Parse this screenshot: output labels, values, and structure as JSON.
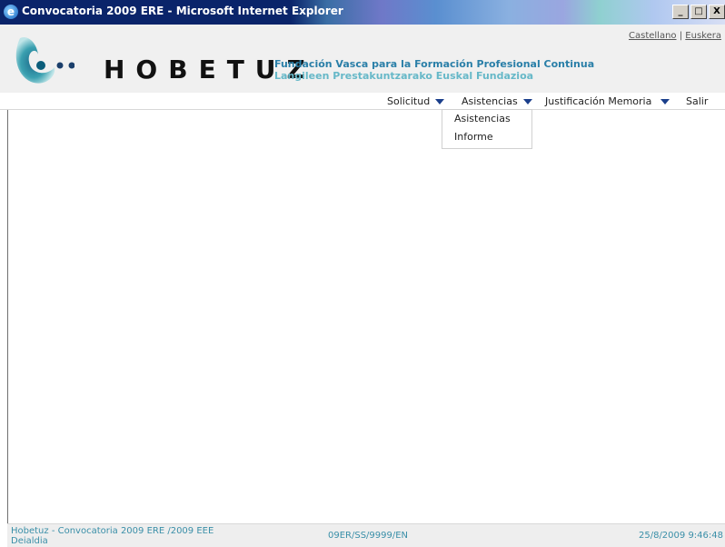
{
  "window": {
    "title": "Convocatoria 2009 ERE - Microsoft Internet Explorer",
    "icon": "ie-icon",
    "buttons": [
      "_",
      "□",
      "X"
    ]
  },
  "header": {
    "lang_castellano": "Castellano",
    "lang_separator": "|",
    "lang_euskera": "Euskera",
    "brand": "HOBETUZ",
    "tagline_line1": "Fundación Vasca para la Formación Profesional Continua",
    "tagline_line2": "Langileen Prestakuntzarako Euskal Fundazioa"
  },
  "nav": {
    "solicitud": "Solicitud",
    "asistencias": "Asistencias",
    "justificacion": "Justificación Memoria",
    "salir": "Salir"
  },
  "dropdown": {
    "items": [
      "Asistencias",
      "Informe"
    ]
  },
  "footer": {
    "left_line1": "Hobetuz - Convocatoria 2009 ERE /2009 EEE",
    "left_line2": "Deialdia",
    "center": "09ER/SS/9999/EN",
    "right": "25/8/2009 9:46:48"
  },
  "colors": {
    "title_bar": "#0a246a",
    "accent": "#2a7fa8",
    "nav_arrow": "#1b3f8b"
  }
}
